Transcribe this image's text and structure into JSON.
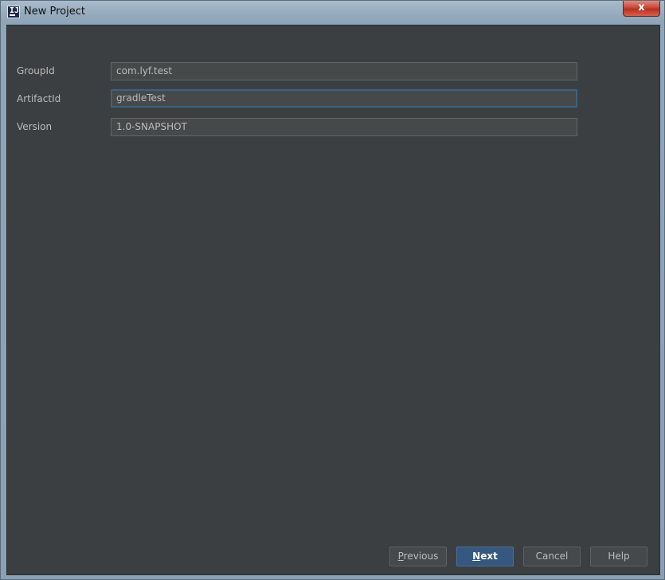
{
  "window": {
    "title": "New Project",
    "close_label": "x"
  },
  "form": {
    "fields": [
      {
        "label": "GroupId",
        "value": "com.lyf.test"
      },
      {
        "label": "ArtifactId",
        "value": "gradleTest"
      },
      {
        "label": "Version",
        "value": "1.0-SNAPSHOT"
      }
    ]
  },
  "buttons": {
    "previous_mnemonic": "P",
    "previous_rest": "revious",
    "next_mnemonic": "N",
    "next_rest": "ext",
    "cancel": "Cancel",
    "help": "Help"
  },
  "colors": {
    "background": "#3c3f41",
    "input_background": "#45494a",
    "focus_border": "#3d6185",
    "primary_button": "#365880"
  },
  "icons": {
    "app": "intellij-icon",
    "close": "close-icon"
  }
}
